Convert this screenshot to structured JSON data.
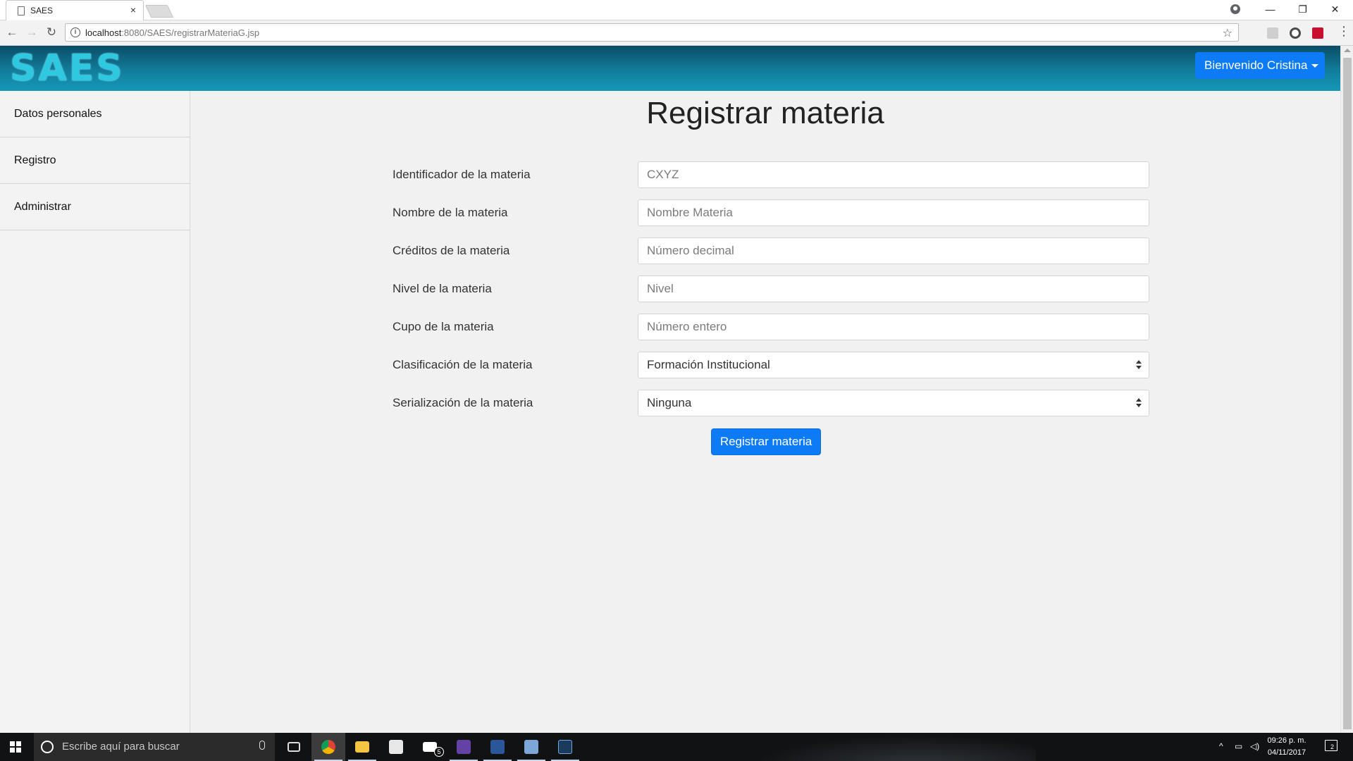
{
  "browser": {
    "tab_title": "SAES",
    "tab_close": "×",
    "url_host": "localhost",
    "url_rest": ":8080/SAES/registrarMateriaG.jsp",
    "window_controls": {
      "minimize": "—",
      "maximize": "❐",
      "close": "✕"
    }
  },
  "header": {
    "logo_text": "SAES",
    "user_menu_label": "Bienvenido Cristina"
  },
  "sidebar": {
    "items": [
      {
        "label": "Datos personales"
      },
      {
        "label": "Registro"
      },
      {
        "label": "Administrar"
      }
    ]
  },
  "form": {
    "title": "Registrar materia",
    "fields": [
      {
        "label": "Identificador de la materia",
        "placeholder": "CXYZ",
        "value": ""
      },
      {
        "label": "Nombre de la materia",
        "placeholder": "Nombre Materia",
        "value": ""
      },
      {
        "label": "Créditos de la materia",
        "placeholder": "Número decimal",
        "value": ""
      },
      {
        "label": "Nivel de la materia",
        "placeholder": "Nivel",
        "value": ""
      },
      {
        "label": "Cupo de la materia",
        "placeholder": "Número entero",
        "value": ""
      }
    ],
    "selects": [
      {
        "label": "Clasificación de la materia",
        "selected": "Formación Institucional"
      },
      {
        "label": "Serialización de la materia",
        "selected": "Ninguna"
      }
    ],
    "submit_label": "Registrar materia"
  },
  "taskbar": {
    "search_placeholder": "Escribe aquí para buscar",
    "mail_badge": "5",
    "time": "09:26 p. m.",
    "date": "04/11/2017",
    "notification_count": "2"
  },
  "colors": {
    "accent_blue": "#0d7bf5",
    "header_gradient_top": "#0a4d66",
    "header_gradient_bottom": "#1598b8",
    "logo": "#2ec9e0"
  }
}
